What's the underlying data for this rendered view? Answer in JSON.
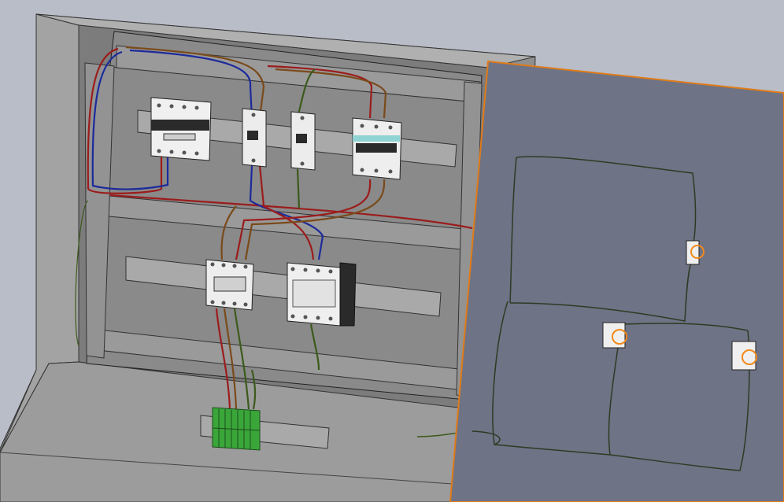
{
  "viewport": {
    "background": "#b9bdc8"
  },
  "colors": {
    "enclosure_outer": "#8c8c8c",
    "enclosure_side": "#a6a6a6",
    "enclosure_inner": "#7a7a7a",
    "backplate": "#858585",
    "din_rail": "#9a9a9a",
    "door_face": "#6e7386",
    "door_edge": "#e07b18",
    "wire_red": "#9b1c1c",
    "wire_blue": "#1c2a9b",
    "wire_brown": "#7a4a1a",
    "wire_green": "#3c5a1c",
    "terminal_green": "#3aa63a",
    "breaker_body": "#f2f2f2",
    "breaker_accent": "#8fd3d3",
    "contactor_dark": "#2a2a2a",
    "switch_ring": "#f28a1a"
  },
  "components": [
    {
      "id": "main-breaker-4p",
      "icon": "circuit-breaker-4-pole"
    },
    {
      "id": "breaker-1p-a",
      "icon": "circuit-breaker-1-pole"
    },
    {
      "id": "breaker-1p-b",
      "icon": "circuit-breaker-1-pole"
    },
    {
      "id": "rcd-breaker",
      "icon": "residual-current-device"
    },
    {
      "id": "contactor",
      "icon": "contactor"
    },
    {
      "id": "control-relay",
      "icon": "relay-module"
    },
    {
      "id": "terminal-block",
      "icon": "green-terminal-block"
    },
    {
      "id": "door-switch-top",
      "icon": "door-push-button"
    },
    {
      "id": "door-switch-left",
      "icon": "door-push-button"
    },
    {
      "id": "door-switch-right",
      "icon": "door-push-button"
    }
  ]
}
